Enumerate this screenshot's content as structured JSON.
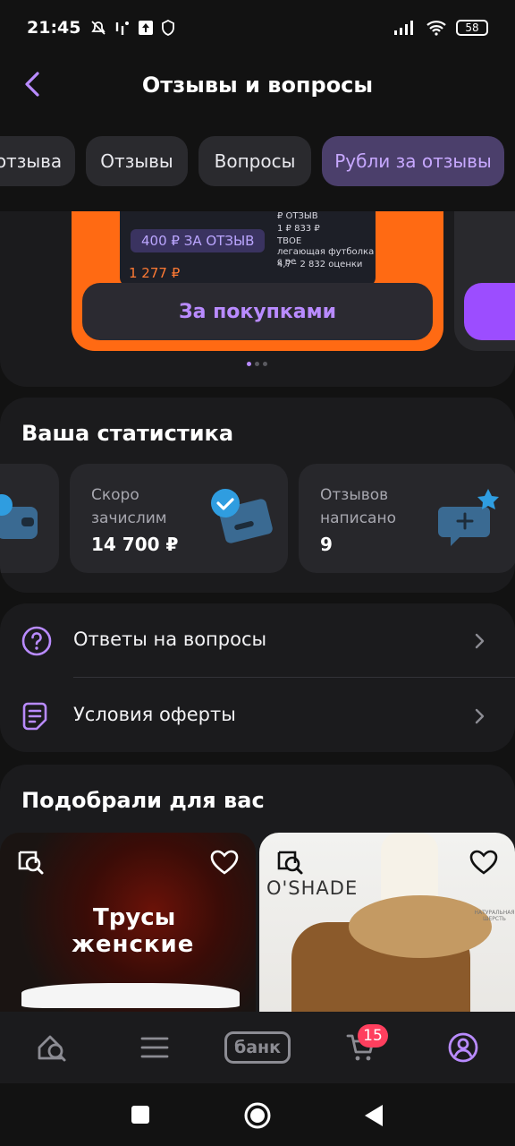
{
  "status_bar": {
    "time": "21:45",
    "battery": "58"
  },
  "header": {
    "title": "Отзывы и вопросы"
  },
  "tabs": [
    {
      "label": "отзыва"
    },
    {
      "label": "Отзывы"
    },
    {
      "label": "Вопросы"
    },
    {
      "label": "Рубли за отзывы",
      "active": true
    }
  ],
  "promo": {
    "badge": "400 ₽ ЗА ОТЗЫВ",
    "mini_price": "1 277 ₽",
    "mini_lines": [
      "₽ ОТЗЫВ",
      "1 ₽ 833 ₽",
      "ТВОЕ",
      "легающая футболка с ре",
      "4,7 · 2 832 оценки"
    ],
    "cta_label": "За покупками"
  },
  "stats": {
    "title": "Ваша статистика",
    "items": [
      {
        "label": "Скоро зачислим",
        "value": "14 700 ₽"
      },
      {
        "label": "Отзывов написано",
        "value": "9"
      }
    ]
  },
  "menu": {
    "items": [
      {
        "label": "Ответы на вопросы"
      },
      {
        "label": "Условия оферты"
      }
    ]
  },
  "recommend": {
    "title": "Подобрали для вас",
    "products": [
      {
        "line1": "Трусы",
        "line2": "женские"
      },
      {
        "brand": "O'SHADE",
        "wool": "НАТУРАЛЬНАЯ ШЕРСТЬ"
      }
    ]
  },
  "bottom_nav": {
    "bank_label": "банк",
    "cart_count": "15"
  },
  "colors": {
    "accent": "#b98bff",
    "active_tab_bg": "#4b3f6b",
    "promo_orange": "#ff6a13",
    "badge_red": "#ff3f5e"
  }
}
